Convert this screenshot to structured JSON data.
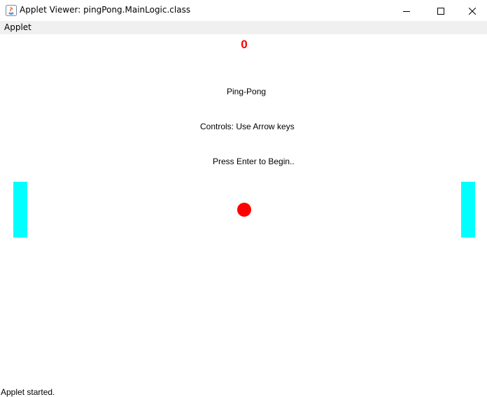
{
  "window": {
    "title": "Applet Viewer: pingPong.MainLogic.class",
    "app_icon": "java-icon",
    "controls": {
      "minimize_icon": "minimize-icon",
      "maximize_icon": "maximize-icon",
      "close_icon": "close-icon"
    }
  },
  "menubar": {
    "items": [
      {
        "label": "Applet"
      }
    ]
  },
  "game": {
    "score": "0",
    "title": "Ping-Pong",
    "controls_text": "Controls: Use Arrow keys",
    "start_text": "Press Enter to Begin..",
    "colors": {
      "score": "#ff0000",
      "paddle": "#00ffff",
      "ball": "#ff0000"
    }
  },
  "status": {
    "text": "Applet started."
  }
}
